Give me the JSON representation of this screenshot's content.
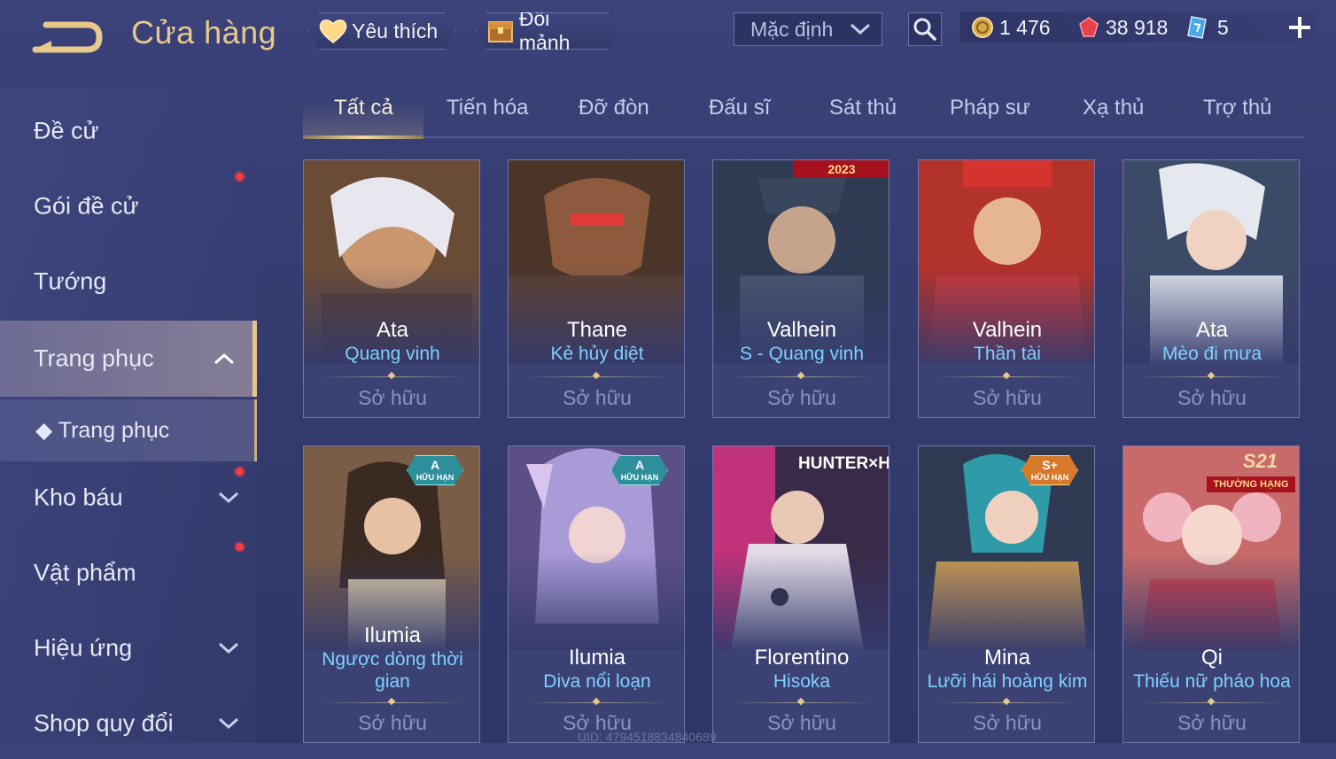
{
  "header": {
    "title": "Cửa hàng",
    "favorites_label": "Yêu thích",
    "exchange_label": "Đổi mảnh",
    "sort_label": "Mặc định",
    "currencies": [
      {
        "name": "coin-icon",
        "value": "1 476"
      },
      {
        "name": "ruby-icon",
        "value": "38 918"
      },
      {
        "name": "voucher-icon",
        "value": "5"
      }
    ]
  },
  "sidebar": {
    "items": [
      {
        "label": "Đề cử"
      },
      {
        "label": "Gói đề cử"
      },
      {
        "label": "Tướng"
      },
      {
        "label": "Trang phục"
      },
      {
        "label": "Trang phục"
      },
      {
        "label": "Kho báu"
      },
      {
        "label": "Vật phẩm"
      },
      {
        "label": "Hiệu ứng"
      },
      {
        "label": "Shop quy đổi"
      }
    ]
  },
  "tabs": [
    "Tất cả",
    "Tiến hóa",
    "Đỡ đòn",
    "Đấu sĩ",
    "Sát thủ",
    "Pháp sư",
    "Xạ thủ",
    "Trợ thủ"
  ],
  "owned_label": "Sở hữu",
  "cards": [
    {
      "hero": "Ata",
      "skin": "Quang vinh",
      "ribbon": "",
      "badge": "",
      "badge_sub": ""
    },
    {
      "hero": "Thane",
      "skin": "Kẻ hủy diệt",
      "ribbon": "",
      "badge": "",
      "badge_sub": ""
    },
    {
      "hero": "Valhein",
      "skin": "S - Quang vinh",
      "ribbon": "2023",
      "badge": "",
      "badge_sub": ""
    },
    {
      "hero": "Valhein",
      "skin": "Thần tài",
      "ribbon": "",
      "badge": "",
      "badge_sub": ""
    },
    {
      "hero": "Ata",
      "skin": "Mèo đi mưa",
      "ribbon": "",
      "badge": "",
      "badge_sub": ""
    },
    {
      "hero": "Ilumia",
      "skin": "Ngược dòng thời gian",
      "ribbon": "",
      "badge": "A",
      "badge_sub": "HỮU HẠN"
    },
    {
      "hero": "Ilumia",
      "skin": "Diva nổi loạn",
      "ribbon": "",
      "badge": "A",
      "badge_sub": "HỮU HẠN"
    },
    {
      "hero": "Florentino",
      "skin": "Hisoka",
      "ribbon": "HUNTER×HUNTER",
      "badge": "",
      "badge_sub": ""
    },
    {
      "hero": "Mina",
      "skin": "Lưỡi hái hoàng kim",
      "ribbon": "",
      "badge": "S+",
      "badge_sub": "HỮU HẠN"
    },
    {
      "hero": "Qi",
      "skin": "Thiếu nữ pháo hoa",
      "ribbon": "S21",
      "badge": "THƯỜNG HẠNG",
      "badge_sub": ""
    }
  ],
  "uid_text": "UID: 4794518834840689",
  "colors": {
    "accent_gold": "#e7c98a",
    "skin_name": "#7fd0ff",
    "notification": "#ff3b3b"
  }
}
